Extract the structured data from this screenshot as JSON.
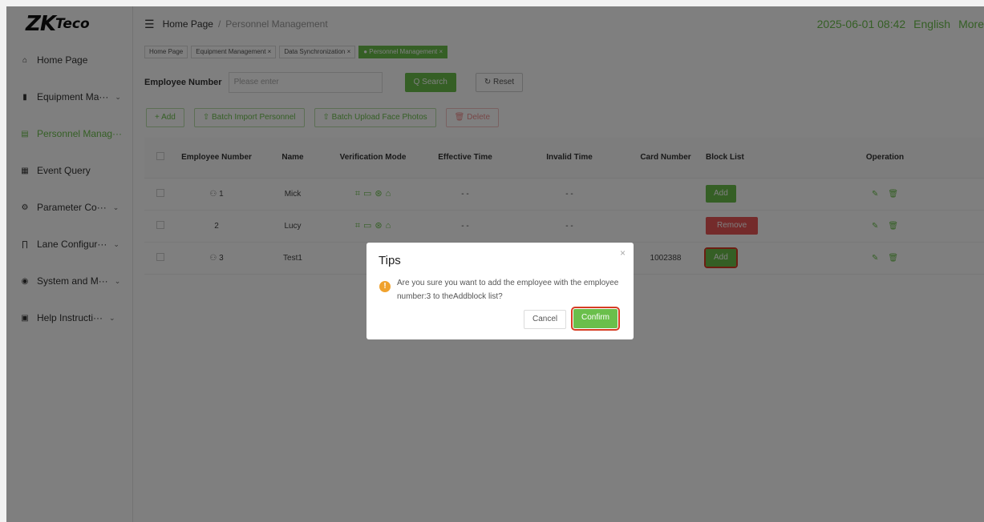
{
  "sidebar": {
    "logo_main": "ZK",
    "logo_sub": "Teco",
    "items": [
      {
        "label": "Home Page",
        "icon": "home-icon"
      },
      {
        "label": "Equipment Ma···",
        "icon": "device-icon"
      },
      {
        "label": "Personnel Manag···",
        "icon": "personnel-icon"
      },
      {
        "label": "Event Query",
        "icon": "event-icon"
      },
      {
        "label": "Parameter Co···",
        "icon": "parameter-icon"
      },
      {
        "label": "Lane Configur···",
        "icon": "lane-icon"
      },
      {
        "label": "System and M···",
        "icon": "system-icon"
      },
      {
        "label": "Help Instructi···",
        "icon": "help-icon"
      }
    ]
  },
  "header": {
    "breadcrumb_home": "Home Page",
    "breadcrumb_sep": "/",
    "breadcrumb_current": "Personnel Management",
    "datetime": "2025-06-01 08:42",
    "language": "English",
    "more": "More"
  },
  "tabs": [
    {
      "label": "Home Page"
    },
    {
      "label": "Equipment Management ×"
    },
    {
      "label": "Data Synchronization ×"
    },
    {
      "label": "● Personnel Management ×"
    }
  ],
  "search": {
    "label": "Employee Number",
    "placeholder": "Please enter",
    "search_btn": "Q Search",
    "reset_btn": "↻ Reset"
  },
  "actions": {
    "add": "+ Add",
    "batch_import": "⇧ Batch Import Personnel",
    "batch_upload": "⇧ Batch Upload Face Photos",
    "delete": "🗑 Delete"
  },
  "table": {
    "headers": [
      "",
      "Employee Number",
      "Name",
      "Verification Mode",
      "Effective Time",
      "Invalid Time",
      "Card Number",
      "Block List",
      "Operation"
    ],
    "rows": [
      {
        "number": "1",
        "name": "Mick",
        "effective": "- -",
        "invalid": "- -",
        "card": "",
        "block": "Add"
      },
      {
        "number": "2",
        "name": "Lucy",
        "effective": "- -",
        "invalid": "- -",
        "card": "",
        "block": "Remove"
      },
      {
        "number": "3",
        "name": "Test1",
        "effective": "",
        "invalid": "",
        "card": "1002388",
        "block": "Add"
      }
    ]
  },
  "dialog": {
    "title": "Tips",
    "close": "×",
    "message": "Are you sure you want to add the employee with the employee number:3 to theAddblock list?",
    "cancel": "Cancel",
    "confirm": "Confirm"
  },
  "colors": {
    "accent": "#6abf4b",
    "danger": "#e85656",
    "highlight": "#d73d24",
    "warning": "#f0a22e"
  }
}
